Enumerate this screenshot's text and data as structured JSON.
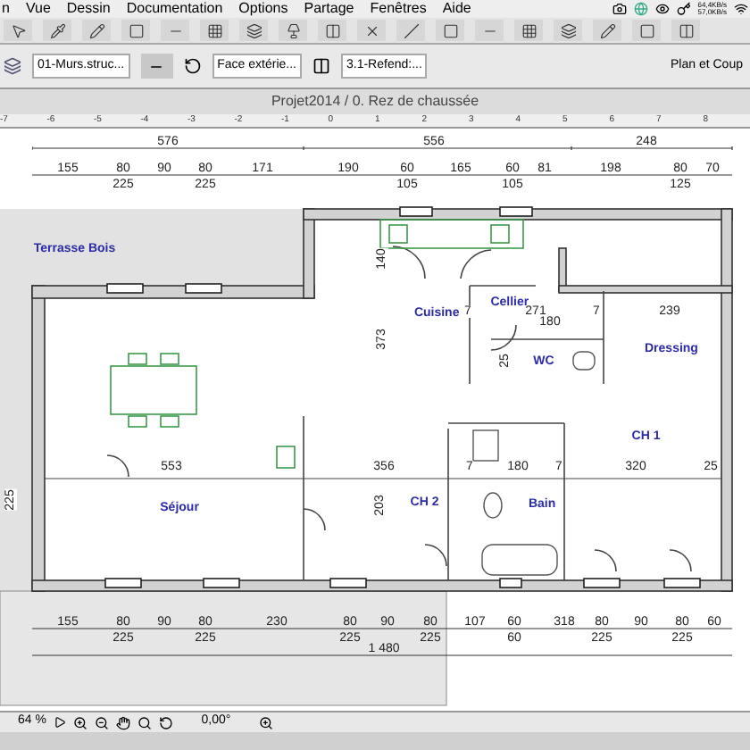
{
  "menu_bar": {
    "items": [
      "n",
      "Vue",
      "Dessin",
      "Documentation",
      "Options",
      "Partage",
      "Fenêtres",
      "Aide"
    ],
    "network_speeds": [
      "64,4KB/s",
      "57,0KB/s"
    ]
  },
  "info_box": {
    "layer": "01-Murs.struc...",
    "face": "Face extérie...",
    "material": "3.1-Refend:...",
    "view": "Plan et Coup"
  },
  "window": {
    "title": "Projet2014 / 0. Rez de chaussée"
  },
  "ruler": {
    "ticks": [
      "-7",
      "-6",
      "-5",
      "-4",
      "-3",
      "-2",
      "-1",
      "0",
      "1",
      "2",
      "3",
      "4",
      "5",
      "6",
      "7",
      "8"
    ]
  },
  "plan": {
    "rooms": [
      "Terrasse Bois",
      "Cuisine",
      "Cellier",
      "WC",
      "Dressing",
      "CH 1",
      "Séjour",
      "CH 2",
      "Bain"
    ],
    "dimension_chains": [
      {
        "kind": "top_overall",
        "values": [
          {
            "text": "576"
          },
          {
            "text": "556"
          },
          {
            "text": "248"
          }
        ]
      },
      {
        "kind": "top_detail",
        "values": [
          {
            "text": "155"
          },
          {
            "text": "80",
            "below": "225"
          },
          {
            "text": "90"
          },
          {
            "text": "80",
            "below": "225"
          },
          {
            "text": "171"
          },
          {
            "text": "190"
          },
          {
            "text": "60",
            "below": "105"
          },
          {
            "text": "165"
          },
          {
            "text": "60",
            "below": "105"
          },
          {
            "text": "81"
          },
          {
            "text": "198"
          },
          {
            "text": "80",
            "below": "125"
          },
          {
            "text": "70"
          }
        ]
      },
      {
        "kind": "bottom_detail",
        "values": [
          {
            "text": "155"
          },
          {
            "text": "80",
            "below": "225"
          },
          {
            "text": "90"
          },
          {
            "text": "80",
            "below": "225"
          },
          {
            "text": "230"
          },
          {
            "text": "80",
            "below": "225"
          },
          {
            "text": "90"
          },
          {
            "text": "80",
            "below": "225"
          },
          {
            "text": "107"
          },
          {
            "text": "60",
            "below": "60"
          },
          {
            "text": "318"
          },
          {
            "text": "80",
            "below": "225"
          },
          {
            "text": "90"
          },
          {
            "text": "80",
            "below": "225"
          },
          {
            "text": "60"
          }
        ]
      },
      {
        "kind": "bottom_total",
        "values": [
          {
            "text": "1 480"
          }
        ]
      }
    ],
    "interior_dimensions": [
      {
        "text": "553",
        "kind": "horizontal"
      },
      {
        "text": "356",
        "kind": "horizontal"
      },
      {
        "text": "7",
        "kind": "horizontal"
      },
      {
        "text": "180",
        "kind": "horizontal"
      },
      {
        "text": "7",
        "kind": "horizontal"
      },
      {
        "text": "320",
        "kind": "horizontal"
      },
      {
        "text": "25",
        "kind": "horizontal"
      },
      {
        "text": "7",
        "kind": "horizontal"
      },
      {
        "text": "271",
        "kind": "horizontal"
      },
      {
        "text": "7",
        "kind": "horizontal"
      },
      {
        "text": "239",
        "kind": "horizontal"
      },
      {
        "text": "180",
        "kind": "horizontal"
      },
      {
        "text": "140",
        "kind": "vertical"
      },
      {
        "text": "373",
        "kind": "vertical"
      },
      {
        "text": "25",
        "kind": "vertical"
      },
      {
        "text": "203",
        "kind": "vertical"
      },
      {
        "text": "225",
        "kind": "vertical"
      }
    ]
  },
  "status_bar": {
    "zoom": "64 %",
    "angle": "0,00°"
  }
}
